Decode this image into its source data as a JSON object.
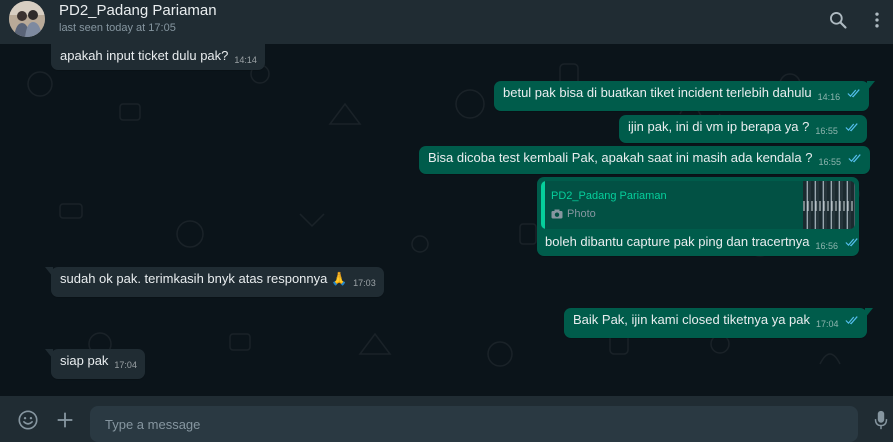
{
  "header": {
    "contact_name": "PD2_Padang Pariaman",
    "last_seen": "last seen today at 17:05",
    "avatar_icon": "avatar-photo",
    "search_icon": "search-icon",
    "menu_icon": "menu-icon"
  },
  "messages": [
    {
      "dir": "in",
      "text": "apakah input ticket dulu pak?",
      "time": "14:14"
    },
    {
      "dir": "out",
      "text": "betul pak bisa di buatkan tiket incident terlebih dahulu",
      "time": "14:16"
    },
    {
      "dir": "out",
      "text": "ijin pak, ini di vm ip berapa ya ?",
      "time": "16:55"
    },
    {
      "dir": "out",
      "text": "Bisa dicoba test kembali Pak, apakah saat ini masih ada kendala ?",
      "time": "16:55"
    },
    {
      "dir": "out",
      "text": "boleh dibantu capture pak ping dan tracertnya",
      "time": "16:56",
      "quote": {
        "name": "PD2_Padang Pariaman",
        "type": "Photo"
      }
    },
    {
      "dir": "in",
      "text": "sudah ok pak. terimkasih bnyk atas responnya 🙏",
      "time": "17:03"
    },
    {
      "dir": "out",
      "text": "Baik Pak, ijin kami closed tiketnya ya pak",
      "time": "17:04"
    },
    {
      "dir": "in",
      "text": "siap pak",
      "time": "17:04"
    }
  ],
  "composer": {
    "placeholder": "Type a message",
    "emoji_icon": "emoji-icon",
    "attach_icon": "plus-icon",
    "mic_icon": "mic-icon"
  },
  "colors": {
    "header_bg": "#202c33",
    "chat_bg": "#0b141a",
    "incoming_bubble": "#202c33",
    "outgoing_bubble": "#005c4b",
    "read_ticks": "#53bdeb",
    "accent": "#06cf9c"
  }
}
